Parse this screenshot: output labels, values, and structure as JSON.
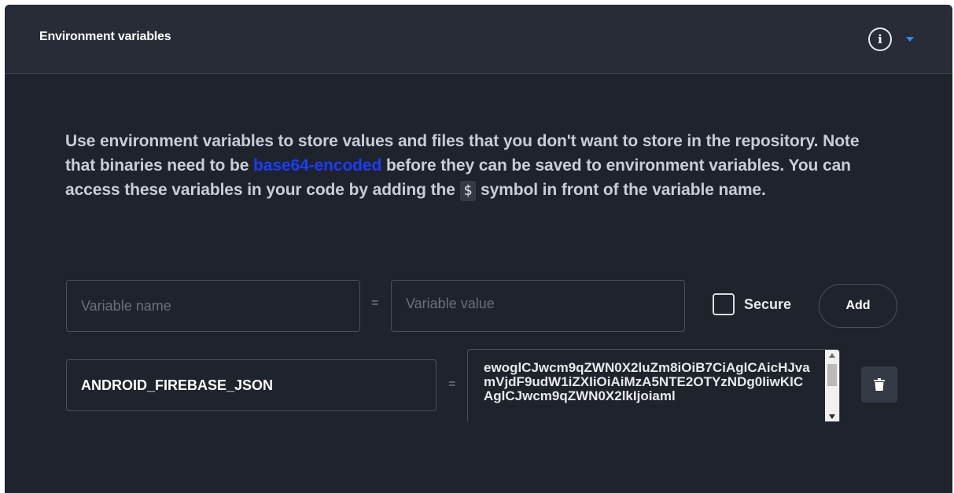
{
  "panel": {
    "title": "Environment variables",
    "info_icon": "info-icon",
    "collapse_icon": "chevron-down-icon",
    "accent_color": "#2d8cf0"
  },
  "description": {
    "part1": "Use environment variables to store values and files that you don't want to store in the repository. Note that binaries need to be ",
    "link": "base64-encoded",
    "part2": " before they can be saved to environment variables. You can access these variables in your code by adding the ",
    "code": "$",
    "part3": " symbol in front of the variable name."
  },
  "new_variable": {
    "name_placeholder": "Variable name",
    "equals": "=",
    "value_placeholder": "Variable value",
    "secure_label": "Secure",
    "secure_checked": false,
    "add_label": "Add"
  },
  "variables": [
    {
      "name": "ANDROID_FIREBASE_JSON",
      "equals": "=",
      "value": "ewoglCJwcm9qZWN0X2luZm8iOiB7CiAglCAicHJvamVjdF9udW1iZXIiOiAiMzA5NTE2OTYzNDg0IiwKICAglCJwcm9qZWN0X2lkIjoiaml",
      "delete_icon": "trash-icon"
    }
  ]
}
